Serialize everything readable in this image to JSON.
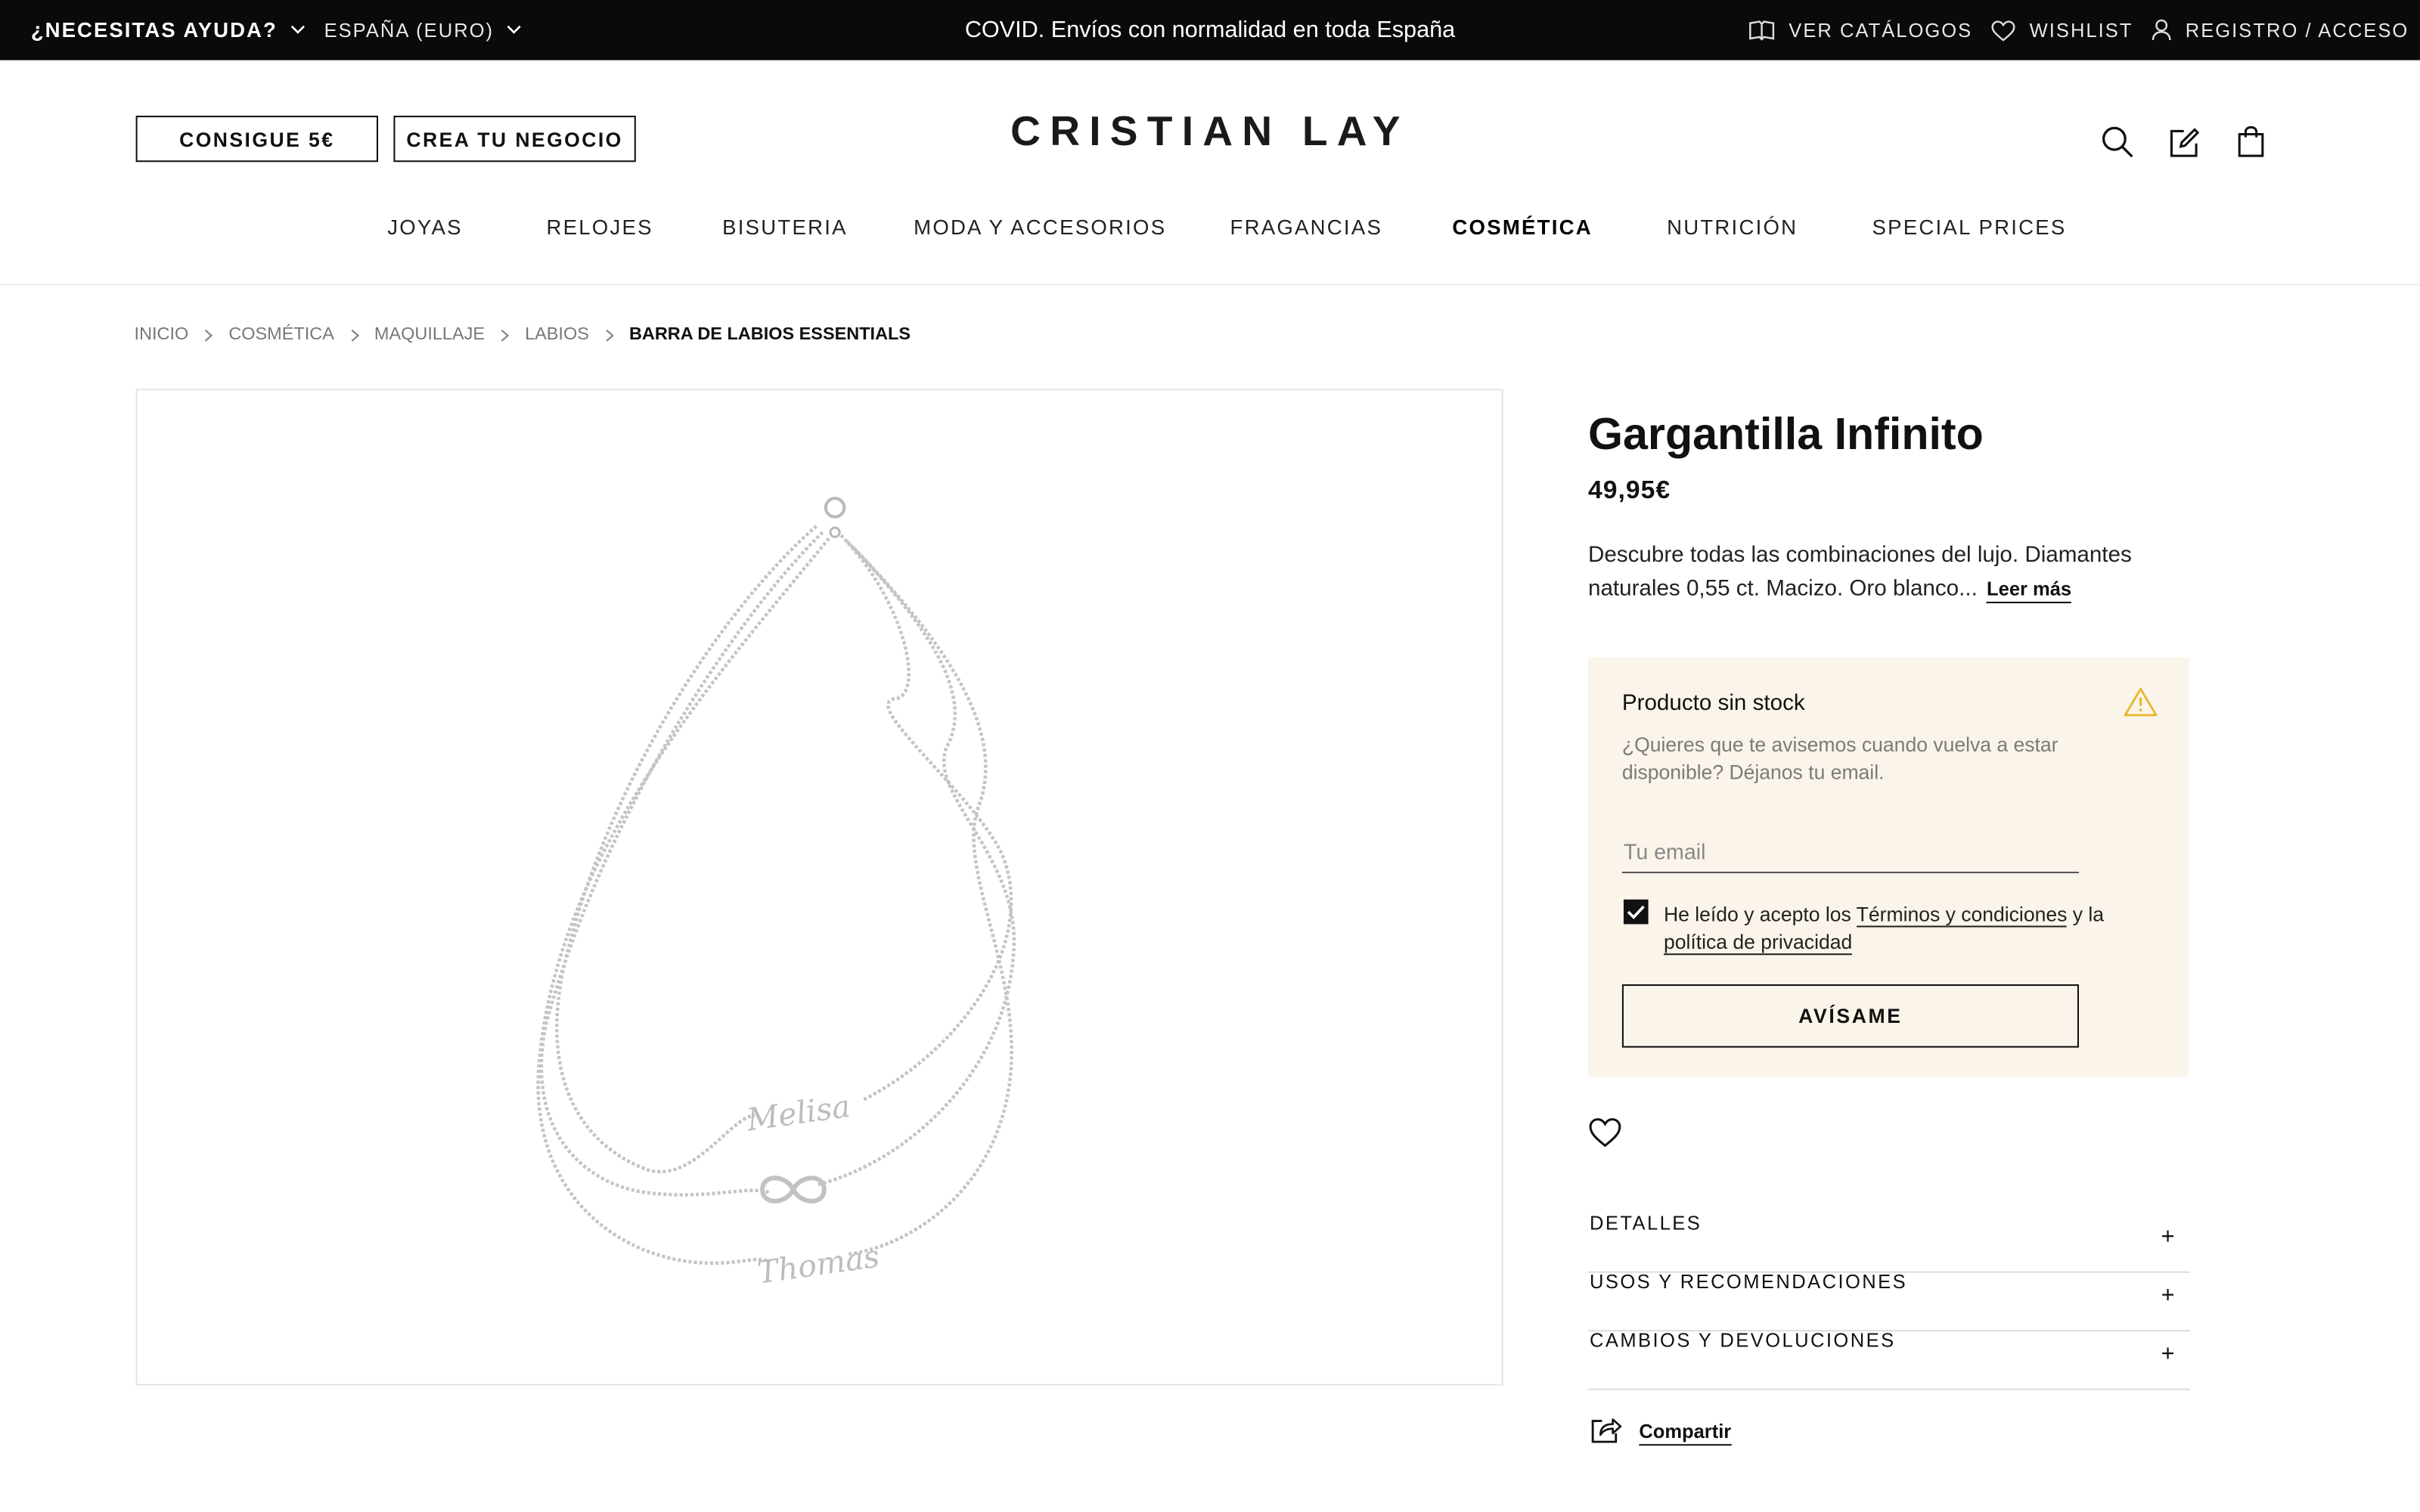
{
  "topbar": {
    "help_label": "¿NECESITAS AYUDA?",
    "country_label": "ESPAÑA (EURO)",
    "announcement": "COVID. Envíos con normalidad en toda España",
    "catalogs_label": "VER CATÁLOGOS",
    "wishlist_label": "WISHLIST",
    "login_label": "REGISTRO / ACCESO"
  },
  "header": {
    "promo_button": "CONSIGUE 5€",
    "business_button": "CREA TU NEGOCIO",
    "logo_text": "CRISTIAN LAY",
    "icons": [
      "search-icon",
      "edit-icon",
      "shopping-bag-icon"
    ]
  },
  "nav": {
    "items": [
      {
        "label": "JOYAS"
      },
      {
        "label": "RELOJES"
      },
      {
        "label": "BISUTERIA"
      },
      {
        "label": "MODA Y ACCESORIOS"
      },
      {
        "label": "FRAGANCIAS"
      },
      {
        "label": "COSMÉTICA",
        "active": true
      },
      {
        "label": "NUTRICIÓN"
      },
      {
        "label": "SPECIAL PRICES"
      }
    ]
  },
  "breadcrumb": {
    "items": [
      "INICIO",
      "COSMÉTICA",
      "MAQUILLAJE",
      "LABIOS"
    ],
    "current": "BARRA DE LABIOS ESSENTIALS"
  },
  "product": {
    "title": "Gargantilla Infinito",
    "price": "49,95€",
    "description": "Descubre todas las combinaciones del lujo. Diamantes naturales 0,55 ct. Macizo. Oro blanco...",
    "read_more": "Leer más",
    "image_alt": "necklace-product-image"
  },
  "stock": {
    "title": "Producto sin stock",
    "subtitle": "¿Quieres que te avisemos cuando vuelva a estar disponible? Déjanos tu email.",
    "email_placeholder": "Tu email",
    "terms_checked": true,
    "terms_prefix": "He leído y acepto los ",
    "terms_link": "Términos y condiciones",
    "terms_middle": " y la ",
    "privacy_link": "política de privacidad",
    "notify_button": "AVÍSAME",
    "accent_color": "#fbf4ea",
    "warning_color": "#e8b830"
  },
  "accordion": {
    "items": [
      {
        "label": "DETALLES",
        "icon": "+"
      },
      {
        "label": "USOS Y RECOMENDACIONES",
        "icon": "+"
      },
      {
        "label": "CAMBIOS Y DEVOLUCIONES",
        "icon": "+"
      }
    ]
  },
  "share": {
    "label": "Compartir"
  }
}
